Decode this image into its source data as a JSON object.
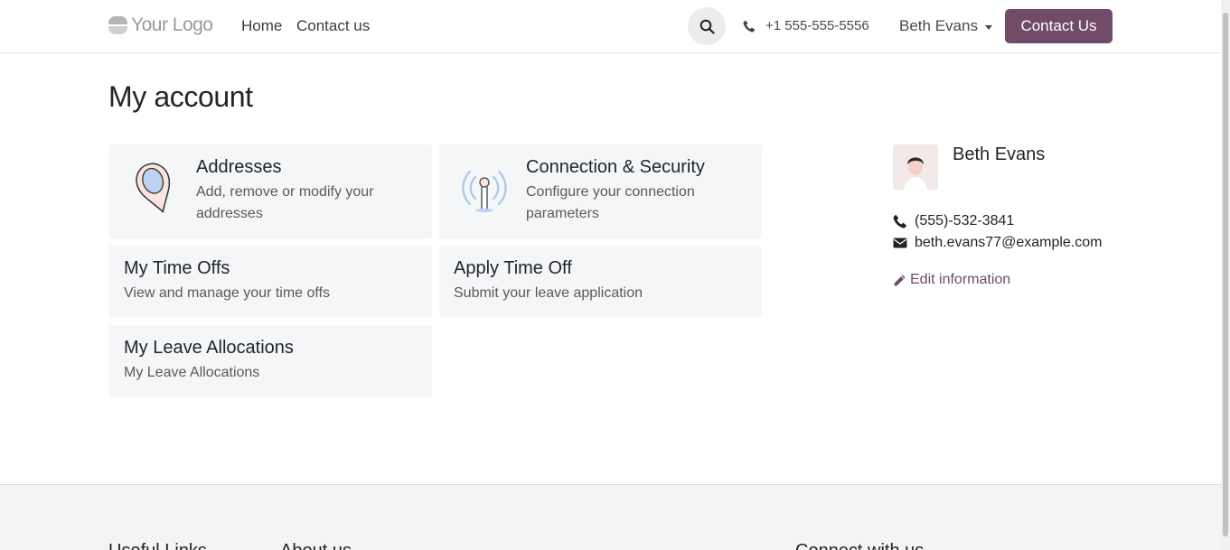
{
  "header": {
    "logo_text": "Your Logo",
    "nav": [
      "Home",
      "Contact us"
    ],
    "phone": "+1 555-555-5556",
    "user_name": "Beth Evans",
    "cta_label": "Contact Us",
    "accent_color": "#714b67"
  },
  "main": {
    "title": "My account",
    "cards": [
      {
        "title": "Addresses",
        "desc_line1": "Add, remove or modify your",
        "desc_line2": "addresses",
        "icon": "map-pin-icon"
      },
      {
        "title": "Connection & Security",
        "desc_line1": "Configure your connection",
        "desc_line2": "parameters",
        "icon": "antenna-icon"
      },
      {
        "title": "My Time Offs",
        "desc": "View and manage your time offs"
      },
      {
        "title": "Apply Time Off",
        "desc": "Submit your leave application"
      },
      {
        "title": "My Leave Allocations",
        "desc": "My Leave Allocations"
      }
    ]
  },
  "profile": {
    "name": "Beth Evans",
    "phone": "(555)-532-3841",
    "email": "beth.evans77@example.com",
    "edit_label": "Edit information"
  },
  "footer": {
    "headings": [
      "Useful Links",
      "About us",
      "Connect with us"
    ]
  }
}
